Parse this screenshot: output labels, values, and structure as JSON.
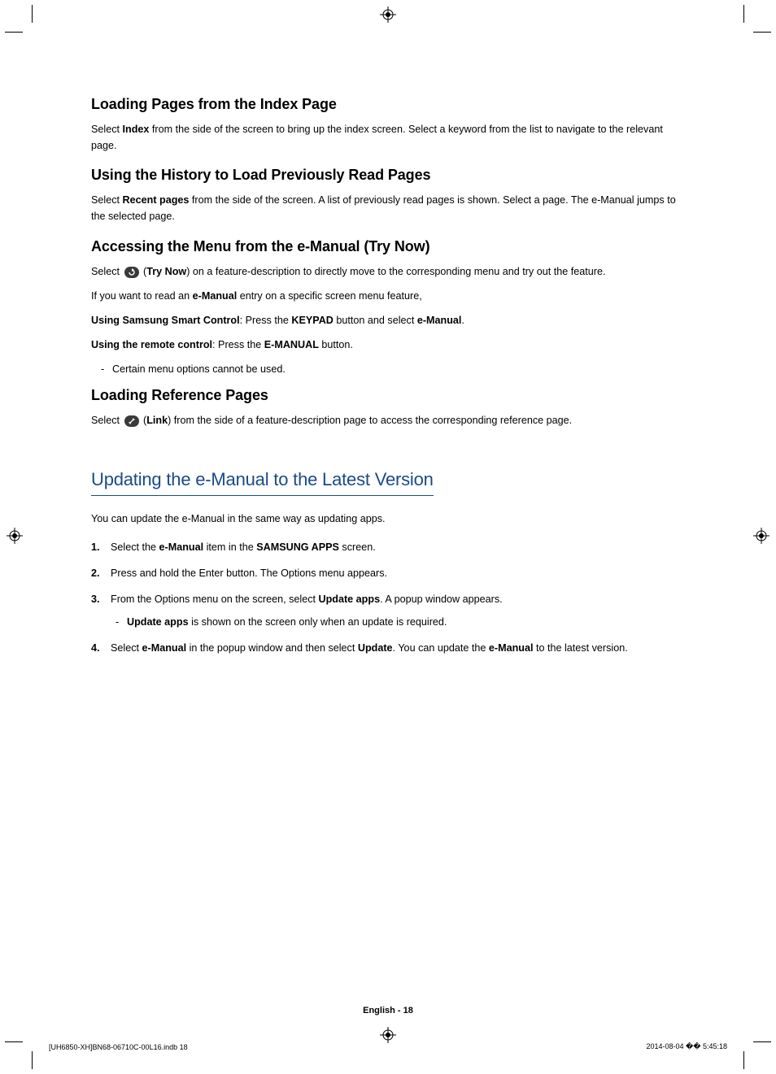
{
  "sections": {
    "s1": {
      "heading": "Loading Pages from the Index Page",
      "p1_pre": "Select ",
      "p1_bold": "Index",
      "p1_post": " from the side of the screen to bring up the index screen. Select a keyword from the list to navigate to the relevant page."
    },
    "s2": {
      "heading": "Using the History to Load Previously Read Pages",
      "p1_pre": "Select ",
      "p1_bold": "Recent pages",
      "p1_post": " from the side of the screen. A list of previously read pages is shown. Select a page. The e-Manual jumps to the selected page."
    },
    "s3": {
      "heading": "Accessing the Menu from the e-Manual (Try Now)",
      "p1_a": "Select ",
      "p1_b": " (",
      "p1_bold": "Try Now",
      "p1_c": ") on a feature-description to directly move to the corresponding menu and try out the feature.",
      "p2_a": "If you want to read an ",
      "p2_bold": "e-Manual",
      "p2_b": " entry on a specific screen menu feature,",
      "p3_bold1": "Using Samsung Smart Control",
      "p3_a": ": Press the ",
      "p3_bold2": "KEYPAD",
      "p3_b": " button and select ",
      "p3_bold3": "e-Manual",
      "p3_c": ".",
      "p4_bold1": "Using the remote control",
      "p4_a": ": Press the ",
      "p4_bold2": "E-MANUAL",
      "p4_b": " button.",
      "note": "Certain menu options cannot be used."
    },
    "s4": {
      "heading": "Loading Reference Pages",
      "p1_a": "Select ",
      "p1_b": " (",
      "p1_bold": "Link",
      "p1_c": ") from the side of a feature-description page to access the corresponding reference page."
    }
  },
  "main_title": "Updating the e-Manual to the Latest Version",
  "intro": "You can update the e-Manual in the same way as updating apps.",
  "steps": {
    "s1": {
      "a": "Select the ",
      "b1": "e-Manual",
      "b": " item in the ",
      "b2": "SAMSUNG APPS",
      "c": " screen."
    },
    "s2": {
      "a": "Press and hold the Enter button. The Options menu appears."
    },
    "s3": {
      "a": "From the Options menu on the screen, select ",
      "b1": "Update apps",
      "b": ". A popup window appears.",
      "note_b1": "Update apps",
      "note_a": " is shown on the screen only when an update is required."
    },
    "s4": {
      "a": "Select ",
      "b1": "e-Manual",
      "b": " in the popup window and then select ",
      "b2": "Update",
      "c": ". You can update the ",
      "b3": "e-Manual",
      "d": " to the latest version."
    }
  },
  "footer": {
    "center": "English - 18",
    "imprint_left": "[UH6850-XH]BN68-06710C-00L16.indb   18",
    "imprint_date": "2014-08-04   �� 5:45:18"
  },
  "icons": {
    "try_now_glyph": "↻",
    "link_glyph": "🔗"
  }
}
